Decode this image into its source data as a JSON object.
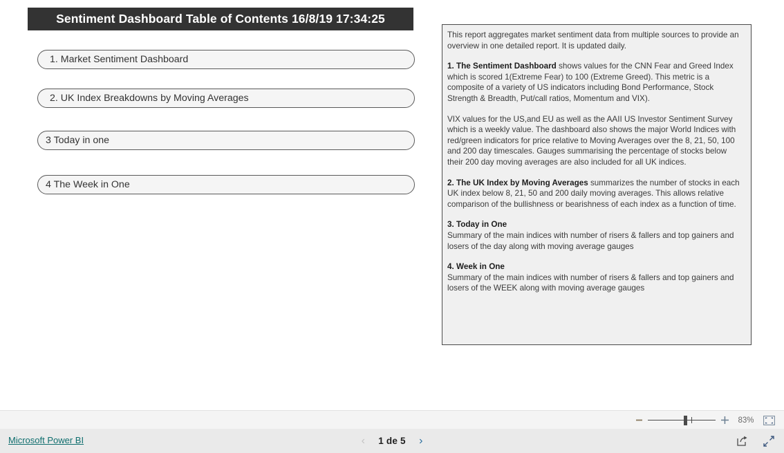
{
  "report": {
    "page_title": "Sentiment Dashboard Table of Contents 16/8/19 17:34:25",
    "toc": {
      "items": [
        {
          "label": "1. Market Sentiment Dashboard"
        },
        {
          "label": "2. UK Index Breakdowns by Moving Averages"
        },
        {
          "label": "3 Today in one"
        },
        {
          "label": "4 The Week in One"
        }
      ]
    },
    "description": {
      "intro": "This report aggregates market sentiment data from multiple sources to provide an overview in one detailed report. It is updated daily.",
      "section1_head": "1. The Sentiment Dashboard",
      "section1_body": " shows values for the CNN Fear and Greed Index which is scored 1(Extreme Fear) to 100 (Extreme Greed). This metric is a composite of a variety of US indicators including Bond Performance, Stock Strength & Breadth, Put/call ratios, Momentum and VIX).",
      "section1_cont": "VIX values for the US,and EU as well as the AAII US Investor Sentiment Survey which is a weekly value. The dashboard also shows the major World Indices with red/green indicators for price relative to Moving Averages over the 8, 21, 50, 100 and 200 day timescales.  Gauges summarising the percentage of stocks below their 200 day moving averages are also included for all UK indices.",
      "section2_head": "2. The UK Index by Moving Averages",
      "section2_body": " summarizes the number of stocks in each UK index below 8, 21, 50 and 200 daily moving averages. This allows relative comparison of the bullishness or bearishness of each index as a function of time.",
      "section3_head": "3. Today in One",
      "section3_body": "Summary of the main indices with number of risers & fallers and top gainers and losers of the day along with moving average gauges",
      "section4_head": "4. Week in One",
      "section4_body": "Summary of the main indices with number of risers & fallers and top gainers and losers of the WEEK along with moving average gauges"
    }
  },
  "toolbar": {
    "zoom_out_label": "–",
    "zoom_in_label": "+",
    "zoom_level": "83%",
    "fit_to_page_icon": "fit-to-page-icon"
  },
  "status_bar": {
    "brand_link": "Microsoft Power BI",
    "pager": {
      "prev_icon": "chevron-left-icon",
      "page_label": "1 de 5",
      "next_icon": "chevron-right-icon"
    },
    "share_icon": "share-icon",
    "fullscreen_icon": "fullscreen-icon"
  },
  "colors": {
    "title_banner_bg": "#333333",
    "button_border": "#595959",
    "button_fill": "#f5f5f5",
    "panel_fill": "#f0f0f0",
    "panel_border": "#4a4a4a",
    "link": "#0f6e6e",
    "pager_next": "#2a6f9e"
  }
}
